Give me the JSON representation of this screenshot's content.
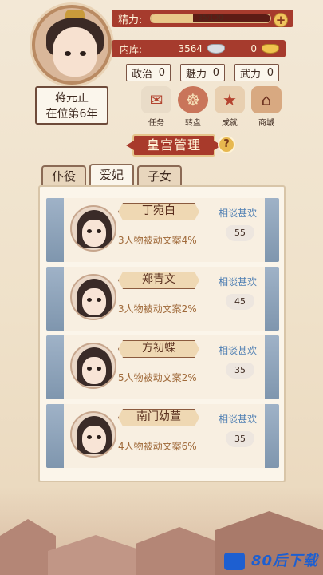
{
  "header": {
    "energy_label": "精力:",
    "energy_text": "35/100",
    "energy_fraction": 0.35,
    "plus_label": "+",
    "treasury_label": "内库:",
    "silver": "3564",
    "gold": "0",
    "name": "蒋元正",
    "reign": "在位第6年"
  },
  "stats": [
    {
      "label": "政治",
      "value": "0"
    },
    {
      "label": "魅力",
      "value": "0"
    },
    {
      "label": "武力",
      "value": "0"
    }
  ],
  "features": [
    {
      "label": "任务",
      "icon": "scroll-icon"
    },
    {
      "label": "转盘",
      "icon": "wheel-icon"
    },
    {
      "label": "成就",
      "icon": "trophy-icon"
    },
    {
      "label": "商城",
      "icon": "shop-icon"
    }
  ],
  "section": {
    "title": "皇宫管理",
    "help": "?"
  },
  "tabs": [
    {
      "label": "仆役",
      "active": false
    },
    {
      "label": "爱妃",
      "active": true
    },
    {
      "label": "子女",
      "active": false
    }
  ],
  "consorts": [
    {
      "name": "丁宛白",
      "desc": "3人物被动文案4%",
      "status": "相谈甚欢",
      "score": "55"
    },
    {
      "name": "郑青文",
      "desc": "3人物被动文案2%",
      "status": "相谈甚欢",
      "score": "45"
    },
    {
      "name": "方初蝶",
      "desc": "5人物被动文案2%",
      "status": "相谈甚欢",
      "score": "35"
    },
    {
      "name": "南门幼萱",
      "desc": "4人物被动文案6%",
      "status": "相谈甚欢",
      "score": "35"
    }
  ],
  "watermark": "80后下载",
  "colors": {
    "accent_red": "#a63b2d",
    "gold": "#e7b84f",
    "status_blue": "#4f7fb3"
  }
}
